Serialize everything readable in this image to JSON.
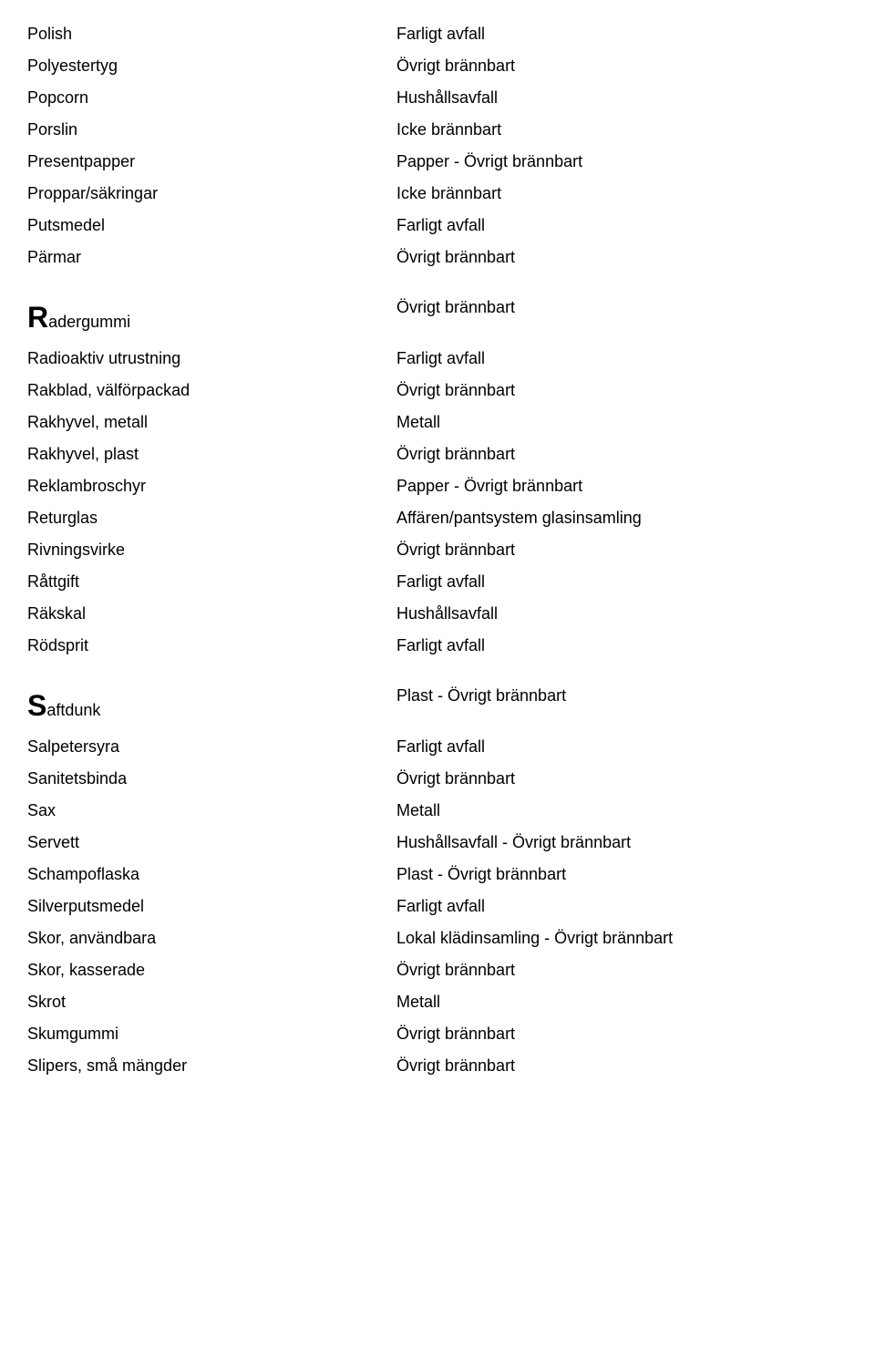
{
  "sections": [
    {
      "letter": null,
      "items": [
        {
          "name": "Polish",
          "category": "Farligt avfall"
        },
        {
          "name": "Polyestertyg",
          "category": "Övrigt brännbart"
        },
        {
          "name": "Popcorn",
          "category": "Hushållsavfall"
        },
        {
          "name": "Porslin",
          "category": "Icke brännbart"
        },
        {
          "name": "Presentpapper",
          "category": "Papper - Övrigt brännbart"
        },
        {
          "name": "Proppar/säkringar",
          "category": "Icke brännbart"
        },
        {
          "name": "Putsmedel",
          "category": "Farligt avfall"
        },
        {
          "name": "Pärmar",
          "category": "Övrigt brännbart"
        }
      ]
    },
    {
      "letter": "R",
      "items": [
        {
          "name": "adergummi",
          "category": "Övrigt brännbart"
        },
        {
          "name": "Radioaktiv utrustning",
          "category": "Farligt avfall"
        },
        {
          "name": "Rakblad, välförpackad",
          "category": "Övrigt brännbart"
        },
        {
          "name": "Rakhyvel, metall",
          "category": "Metall"
        },
        {
          "name": "Rakhyvel, plast",
          "category": "Övrigt brännbart"
        },
        {
          "name": "Reklambroschyr",
          "category": "Papper - Övrigt brännbart"
        },
        {
          "name": "Returglas",
          "category": "Affären/pantsystem glasinsamling"
        },
        {
          "name": "Rivningsvirke",
          "category": "Övrigt brännbart"
        },
        {
          "name": "Råttgift",
          "category": "Farligt avfall"
        },
        {
          "name": "Räkskal",
          "category": "Hushållsavfall"
        },
        {
          "name": "Rödsprit",
          "category": "Farligt avfall"
        }
      ]
    },
    {
      "letter": "S",
      "items": [
        {
          "name": "aftdunk",
          "category": "Plast - Övrigt brännbart"
        },
        {
          "name": "Salpetersyra",
          "category": "Farligt avfall"
        },
        {
          "name": "Sanitetsbinda",
          "category": "Övrigt brännbart"
        },
        {
          "name": "Sax",
          "category": "Metall"
        },
        {
          "name": "Servett",
          "category": "Hushållsavfall - Övrigt brännbart"
        },
        {
          "name": "Schampoflaska",
          "category": "Plast - Övrigt brännbart"
        },
        {
          "name": "Silverputsmedel",
          "category": "Farligt avfall"
        },
        {
          "name": "Skor, användbara",
          "category": "Lokal klädinsamling - Övrigt brännbart"
        },
        {
          "name": "Skor, kasserade",
          "category": "Övrigt brännbart"
        },
        {
          "name": "Skrot",
          "category": "Metall"
        },
        {
          "name": "Skumgummi",
          "category": "Övrigt brännbart"
        },
        {
          "name": "Slipers, små mängder",
          "category": "Övrigt brännbart"
        }
      ]
    }
  ]
}
